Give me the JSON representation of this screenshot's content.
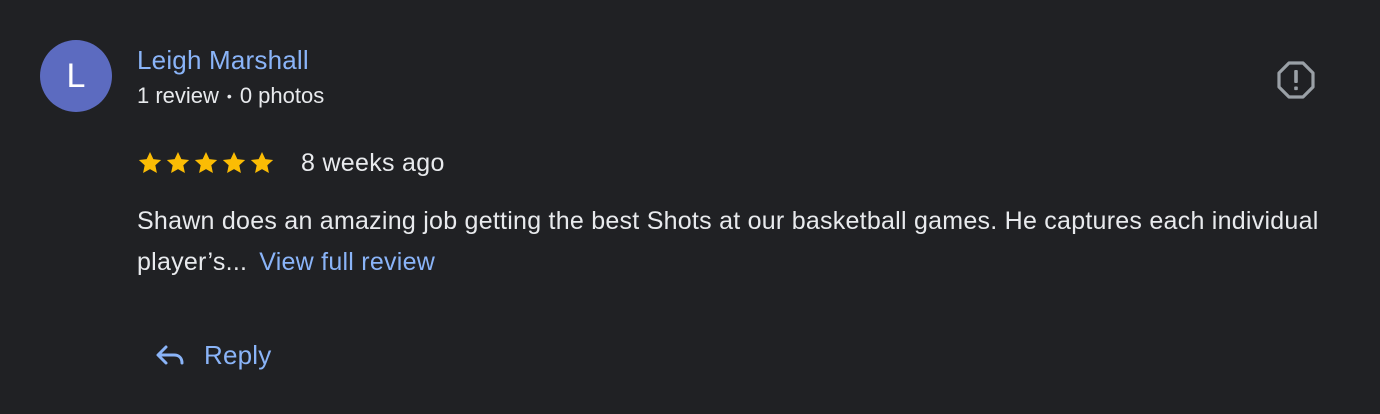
{
  "reviewer": {
    "initial": "L",
    "name": "Leigh Marshall",
    "review_count": "1 review",
    "separator": "•",
    "photo_count": "0 photos",
    "avatar_color": "#5c6bc0"
  },
  "review": {
    "rating": 5,
    "max_rating": 5,
    "time": "8 weeks ago",
    "text": "Shawn does an amazing job getting the best Shots at our basketball games. He captures each individual player’s...",
    "view_full_label": "View full review"
  },
  "actions": {
    "reply_label": "Reply",
    "flag_icon": "report-flag-icon",
    "reply_icon": "reply-arrow-icon"
  },
  "colors": {
    "background": "#202124",
    "link": "#8ab4f8",
    "star": "#fbbc04",
    "text": "#e8eaed"
  }
}
